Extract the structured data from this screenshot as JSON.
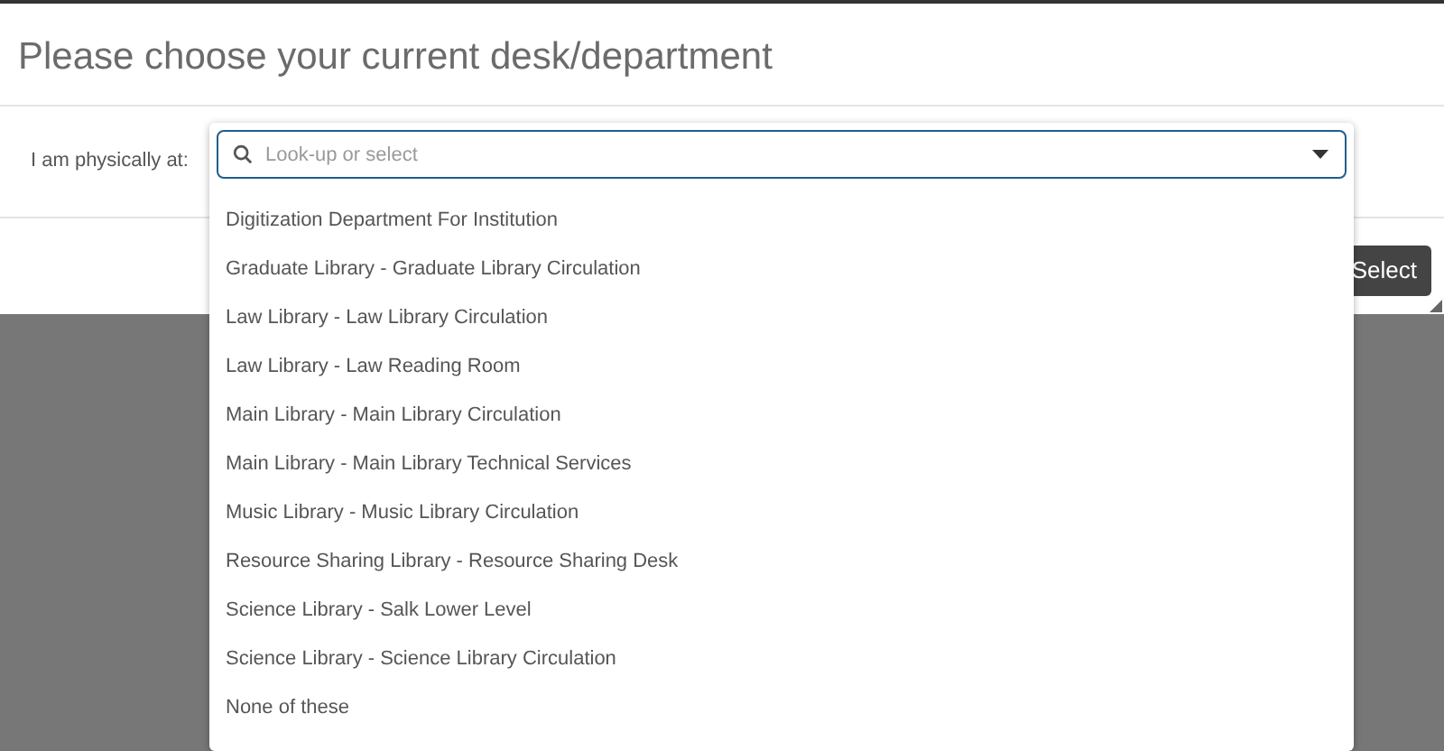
{
  "dialog": {
    "title": "Please choose your current desk/department",
    "field_label": "I am physically at:",
    "search": {
      "placeholder": "Look-up or select"
    },
    "options": [
      {
        "label": "Digitization Department For Institution"
      },
      {
        "label": "Graduate Library - Graduate Library Circulation"
      },
      {
        "label": "Law Library - Law Library Circulation"
      },
      {
        "label": "Law Library - Law Reading Room"
      },
      {
        "label": "Main Library - Main Library Circulation"
      },
      {
        "label": "Main Library - Main Library Technical Services"
      },
      {
        "label": "Music Library - Music Library Circulation"
      },
      {
        "label": "Resource Sharing Library - Resource Sharing Desk"
      },
      {
        "label": "Science Library - Salk Lower Level"
      },
      {
        "label": "Science Library - Science Library Circulation"
      },
      {
        "label": "None of these"
      }
    ],
    "buttons": [
      {
        "label": "Select"
      }
    ]
  }
}
